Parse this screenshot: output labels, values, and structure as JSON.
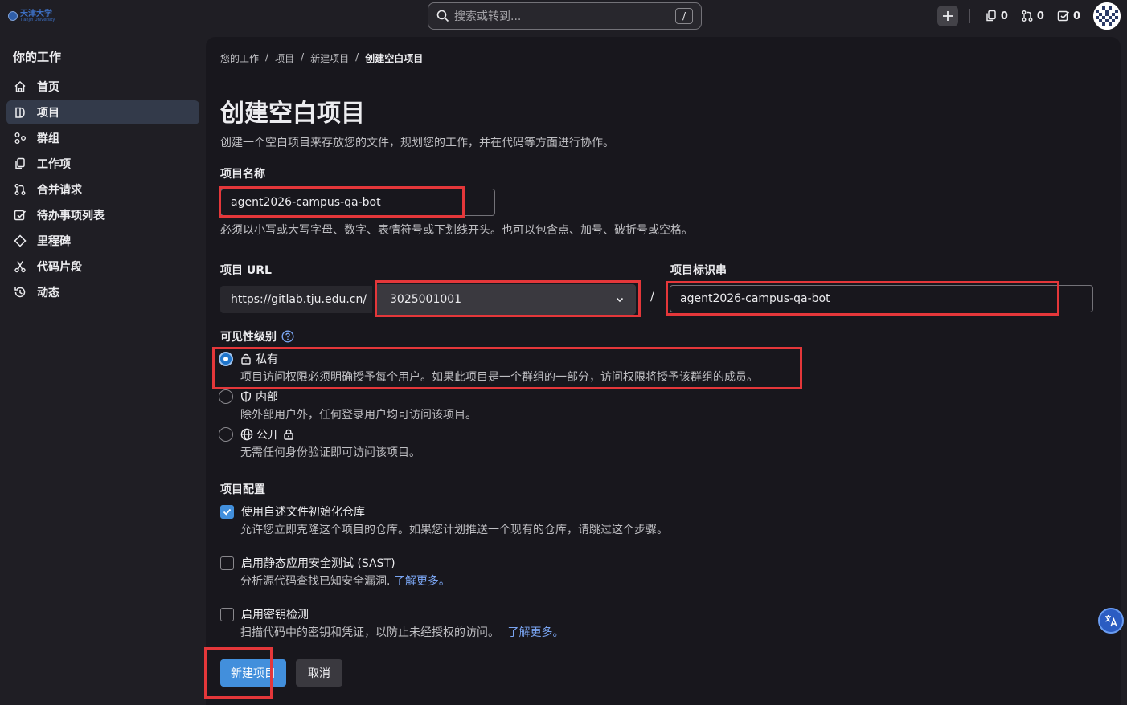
{
  "logo": {
    "line1": "天津大学",
    "line2": "Tianjin University"
  },
  "search": {
    "placeholder": "搜索或转到...",
    "shortcut": "/"
  },
  "top_counters": {
    "issues": "0",
    "merge_requests": "0",
    "todos": "0"
  },
  "sidebar": {
    "title": "你的工作",
    "items": [
      {
        "label": "首页",
        "icon": "home-icon"
      },
      {
        "label": "项目",
        "icon": "project-icon",
        "active": true
      },
      {
        "label": "群组",
        "icon": "group-icon"
      },
      {
        "label": "工作项",
        "icon": "issues-icon"
      },
      {
        "label": "合并请求",
        "icon": "merge-request-icon"
      },
      {
        "label": "待办事项列表",
        "icon": "todo-icon"
      },
      {
        "label": "里程碑",
        "icon": "milestone-icon"
      },
      {
        "label": "代码片段",
        "icon": "snippet-icon"
      },
      {
        "label": "动态",
        "icon": "history-icon"
      }
    ]
  },
  "breadcrumb": [
    "您的工作",
    "项目",
    "新建项目",
    "创建空白项目"
  ],
  "page": {
    "title": "创建空白项目",
    "description": "创建一个空白项目来存放您的文件，规划您的工作，并在代码等方面进行协作。"
  },
  "form": {
    "name_label": "项目名称",
    "name_value": "agent2026-campus-qa-bot",
    "name_help": "必须以小写或大写字母、数字、表情符号或下划线开头。也可以包含点、加号、破折号或空格。",
    "url_label": "项目 URL",
    "url_prefix": "https://gitlab.tju.edu.cn/",
    "namespace_value": "3025001001",
    "slash": "/",
    "slug_label": "项目标识串",
    "slug_value": "agent2026-campus-qa-bot",
    "visibility_label": "可见性级别",
    "visibility": [
      {
        "label": "私有",
        "desc": "项目访问权限必须明确授予每个用户。如果此项目是一个群组的一部分，访问权限将授予该群组的成员。",
        "checked": true
      },
      {
        "label": "内部",
        "desc": "除外部用户外，任何登录用户均可访问该项目。",
        "checked": false
      },
      {
        "label": "公开",
        "desc": "无需任何身份验证即可访问该项目。",
        "checked": false
      }
    ],
    "config_label": "项目配置",
    "config": [
      {
        "label": "使用自述文件初始化仓库",
        "desc": "允许您立即克隆这个项目的仓库。如果您计划推送一个现有的仓库，请跳过这个步骤。",
        "checked": true,
        "link": ""
      },
      {
        "label": "启用静态应用安全测试 (SAST)",
        "desc": "分析源代码查找已知安全漏洞.",
        "checked": false,
        "link": "了解更多。"
      },
      {
        "label": "启用密钥检测",
        "desc": "扫描代码中的密钥和凭证，以防止未经授权的访问。",
        "checked": false,
        "link": "了解更多。"
      }
    ],
    "submit_label": "新建项目",
    "cancel_label": "取消"
  },
  "colors": {
    "accent": "#428fdc",
    "highlight": "#e4373a",
    "background": "#18171d"
  }
}
